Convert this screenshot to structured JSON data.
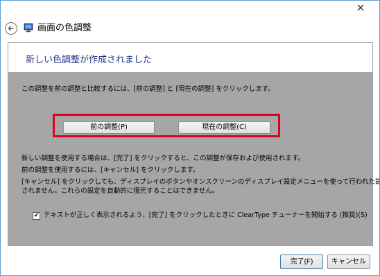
{
  "window": {
    "title": "画面の色調整",
    "icons": {
      "close": "close-icon",
      "back": "back-arrow-icon",
      "app": "monitor-icon"
    }
  },
  "header": {
    "title": "新しい色調整が作成されました"
  },
  "body": {
    "instruction": "この調整を前の調整と比較するには、[前の調整] と [現在の調整] をクリックします。",
    "buttons": {
      "previous": "前の調整(P)",
      "current": "現在の調整(C)"
    },
    "info_line1": "新しい調整を使用する場合は、[完了] をクリックすると、この調整が保存および使用されます。",
    "info_line2": "前の調整を使用するには、[キャンセル] をクリックします。",
    "info_line3a": "[キャンセル] をクリックしても、ディスプレイのボタンやオンスクリーンのディスプレイ設定メニューを使って行われた設定は復元",
    "info_line3b": "されません。これらの設定を自動的に復元することはできません。",
    "checkbox": {
      "checked": true,
      "mark": "✔",
      "label": "テキストが正しく表示されるよう、[完了] をクリックしたときに ClearType チューナーを開始する (推奨)(S)"
    }
  },
  "footer": {
    "finish": "完了(F)",
    "cancel": "キャンセル"
  },
  "colors": {
    "highlight": "#e0001b",
    "header_title": "#1e3287",
    "panel_gray": "#a6a6a6"
  }
}
